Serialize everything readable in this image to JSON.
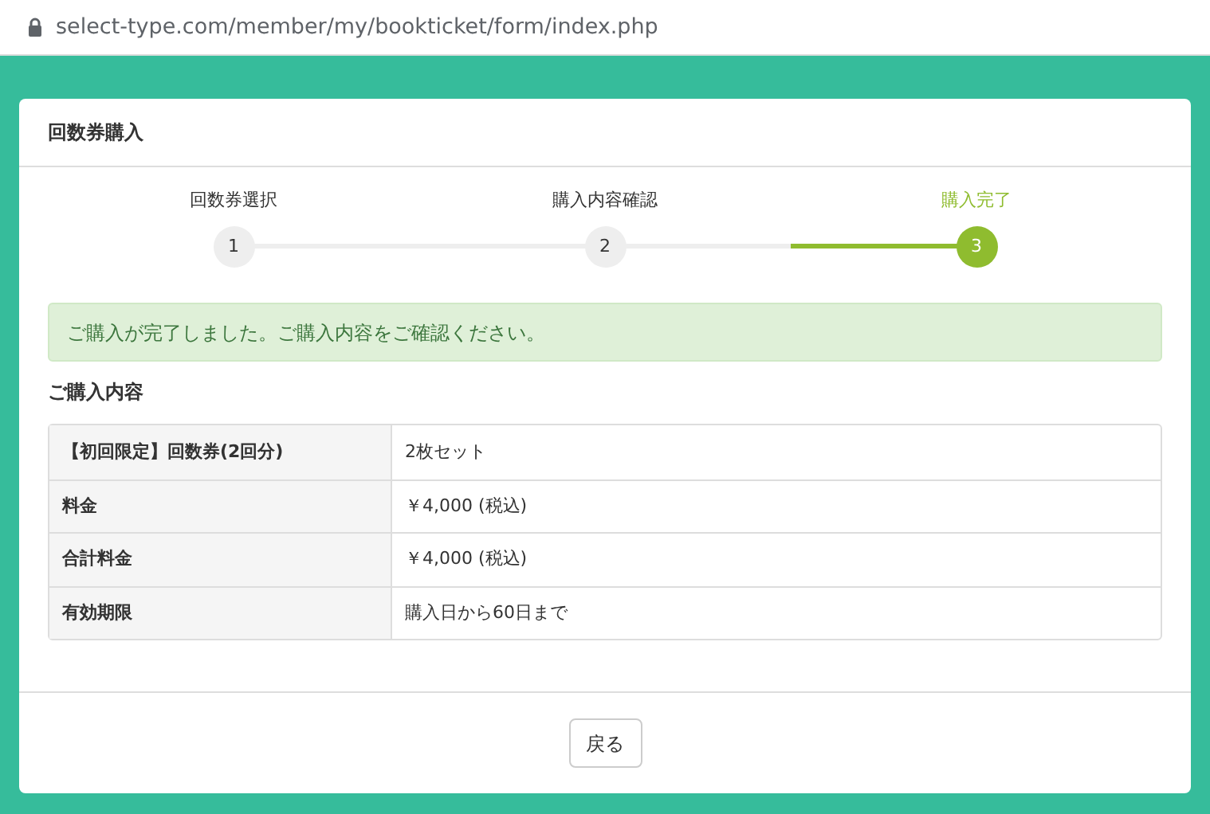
{
  "address_bar": {
    "url": "select-type.com/member/my/bookticket/form/index.php"
  },
  "card": {
    "title": "回数券購入",
    "steps": [
      {
        "label": "回数券選択",
        "number": "1",
        "selected": false
      },
      {
        "label": "購入内容確認",
        "number": "2",
        "selected": false
      },
      {
        "label": "購入完了",
        "number": "3",
        "selected": true
      }
    ],
    "alert": "ご購入が完了しました。ご購入内容をご確認ください。",
    "section_title": "ご購入内容",
    "table": {
      "rows": [
        {
          "label": "【初回限定】回数券(2回分)",
          "value": "2枚セット"
        },
        {
          "label": "料金",
          "value": "￥4,000 (税込)"
        },
        {
          "label": "合計料金",
          "value": "￥4,000 (税込)"
        },
        {
          "label": "有効期限",
          "value": "購入日から60日まで"
        }
      ]
    },
    "back_button": "戻る"
  }
}
